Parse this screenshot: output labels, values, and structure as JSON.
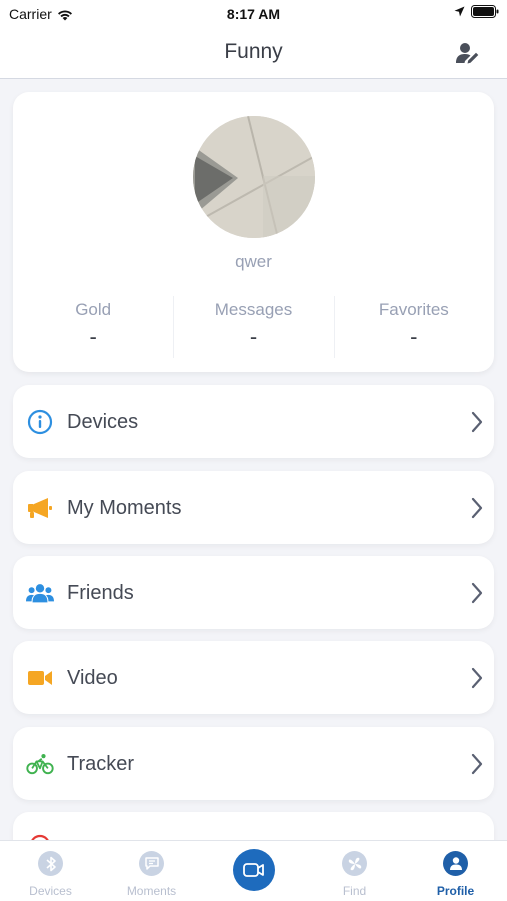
{
  "status_bar": {
    "carrier": "Carrier",
    "time": "8:17 AM"
  },
  "nav": {
    "title": "Funny",
    "edit_icon": "edit-profile-icon"
  },
  "profile": {
    "username": "qwer",
    "stats": [
      {
        "label": "Gold",
        "value": "-"
      },
      {
        "label": "Messages",
        "value": "-"
      },
      {
        "label": "Favorites",
        "value": "-"
      }
    ]
  },
  "menu": [
    {
      "label": "Devices",
      "icon": "info-icon",
      "color": "#2d8fe0"
    },
    {
      "label": "My Moments",
      "icon": "megaphone-icon",
      "color": "#f5a623"
    },
    {
      "label": "Friends",
      "icon": "friends-icon",
      "color": "#2d8fe0"
    },
    {
      "label": "Video",
      "icon": "video-camera-icon",
      "color": "#f5a623"
    },
    {
      "label": "Tracker",
      "icon": "bicycle-icon",
      "color": "#3fb24f"
    }
  ],
  "tabs": [
    {
      "label": "Devices",
      "icon": "bluetooth-icon",
      "active": false
    },
    {
      "label": "Moments",
      "icon": "chat-icon",
      "active": false
    },
    {
      "label": "",
      "icon": "video-record-icon",
      "active": false
    },
    {
      "label": "Find",
      "icon": "fan-icon",
      "active": false
    },
    {
      "label": "Profile",
      "icon": "person-icon",
      "active": true
    }
  ],
  "colors": {
    "accent": "#1e6bbd",
    "inactive_tab": "#b8bfcf",
    "background": "#f3f4f8"
  }
}
